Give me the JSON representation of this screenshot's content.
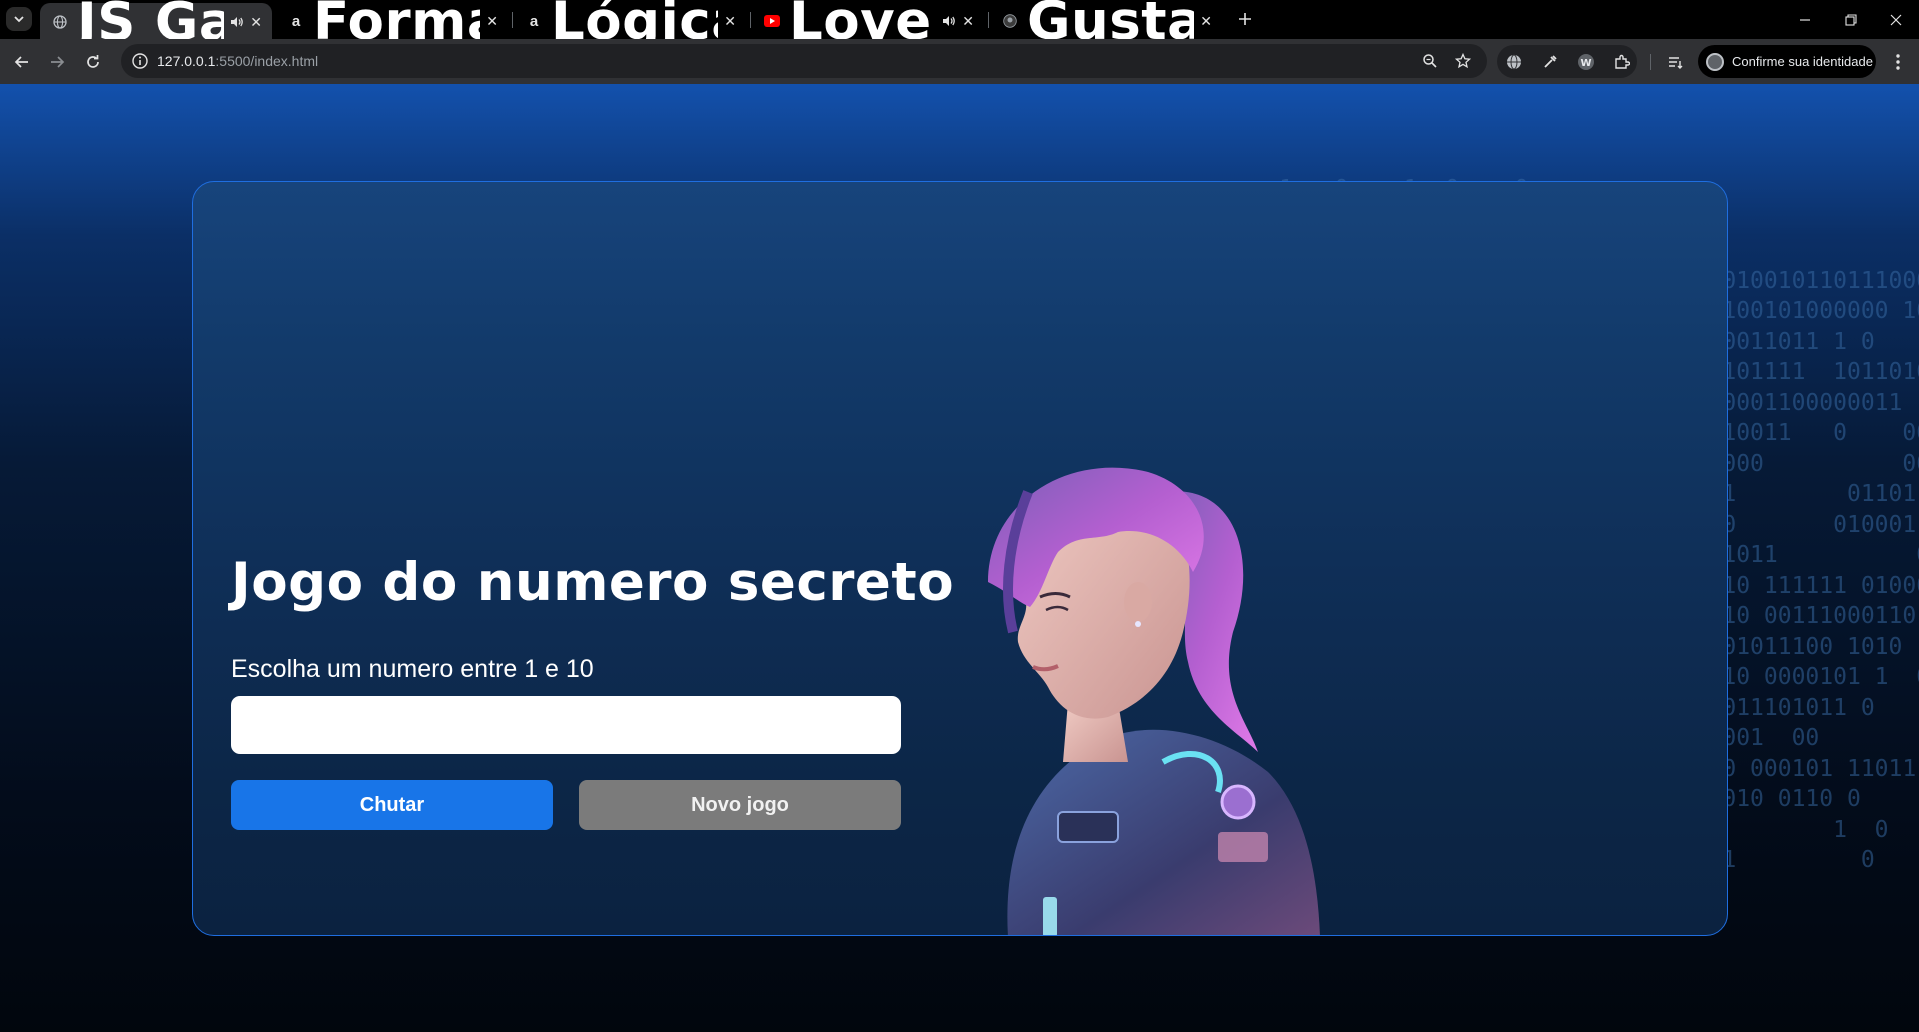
{
  "browser": {
    "tabs": [
      {
        "title": "JS Game",
        "favicon": "globe-icon",
        "audio": true,
        "active": true
      },
      {
        "title": "Formação Iniciante em Program",
        "favicon": "alura-icon",
        "audio": false,
        "active": false
      },
      {
        "title": "Lógica de programação: explor",
        "favicon": "alura-icon",
        "audio": false,
        "active": false
      },
      {
        "title": "Love Me - YouTube",
        "favicon": "youtube-icon",
        "audio": true,
        "active": false
      },
      {
        "title": "Gustavoo-coder/jogo-numero-",
        "favicon": "github-icon",
        "audio": false,
        "active": false
      }
    ],
    "url_host": "127.0.0.1",
    "url_rest": ":5500/index.html",
    "profile_label": "Confirme sua identidade"
  },
  "page": {
    "title": "Jogo do numero secreto",
    "subtitle": "Escolha um numero entre 1 e 10",
    "input_value": "",
    "guess_button": "Chutar",
    "new_game_button": "Novo jogo"
  },
  "colors": {
    "accent": "#1875e8",
    "secondary_button": "#7b7b7b",
    "card_border": "#1f6ee0"
  }
}
